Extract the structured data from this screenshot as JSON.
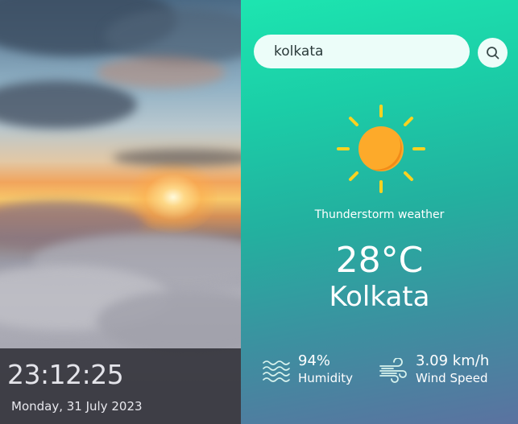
{
  "left_panel": {
    "clock": "23:12:25",
    "date": "Monday, 31 July 2023"
  },
  "search": {
    "value": "kolkata",
    "icon": "search-icon"
  },
  "weather": {
    "icon": "sun-icon",
    "condition": "Thunderstorm weather",
    "temperature": "28°C",
    "city": "Kolkata"
  },
  "stats": {
    "humidity": {
      "icon": "humidity-icon",
      "value": "94%",
      "label": "Humidity"
    },
    "wind": {
      "icon": "wind-icon",
      "value": "3.09 km/h",
      "label": "Wind Speed"
    }
  },
  "colors": {
    "panel_top": "#1de5b0",
    "panel_bottom": "#5b72a0",
    "sun": "#fdaa2a",
    "sun_rays": "#ffd21f"
  }
}
